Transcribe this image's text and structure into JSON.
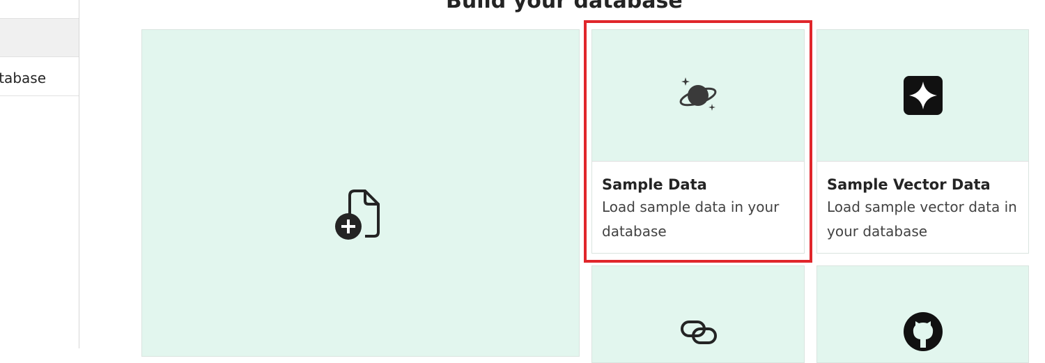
{
  "sidebar": {
    "items": [
      {
        "label": ""
      },
      {
        "label": "tabase"
      }
    ]
  },
  "header": {
    "title": "Build your database"
  },
  "cards": {
    "new_file": {
      "icon": "document-add-icon"
    },
    "sample_data": {
      "title": "Sample Data",
      "description": "Load sample data in your database",
      "icon": "planet-icon"
    },
    "sample_vector": {
      "title": "Sample Vector Data",
      "description": "Load sample vector data in your database",
      "icon": "sparkle-icon"
    },
    "link": {
      "icon": "link-icon"
    },
    "github": {
      "icon": "github-icon"
    }
  },
  "colors": {
    "card_bg": "#e2f6ee",
    "highlight": "#e0262b"
  }
}
